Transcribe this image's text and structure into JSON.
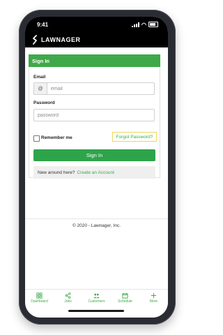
{
  "status": {
    "time": "9:41"
  },
  "header": {
    "brand": "LAWNAGER"
  },
  "signin": {
    "title": "Sign In",
    "email_label": "Email",
    "email_addon": "@",
    "email_placeholder": "email",
    "password_label": "Password",
    "password_placeholder": "password",
    "remember_label": "Remember me",
    "forgot_link": "Forgot Password?",
    "button_label": "Sign In",
    "new_prompt": "New around here?",
    "create_link": "Create an Account"
  },
  "footer": {
    "copyright": "© 2020 - Lawnager, Inc."
  },
  "tabs": [
    {
      "label": "Dashboard",
      "icon": "dashboard-icon"
    },
    {
      "label": "Jobs",
      "icon": "share-icon"
    },
    {
      "label": "Customers",
      "icon": "users-icon"
    },
    {
      "label": "Schedule",
      "icon": "calendar-icon"
    },
    {
      "label": "More",
      "icon": "plus-icon"
    }
  ],
  "colors": {
    "accent": "#3ea948",
    "button": "#2ea44a",
    "highlight_border": "#ecd85a"
  }
}
